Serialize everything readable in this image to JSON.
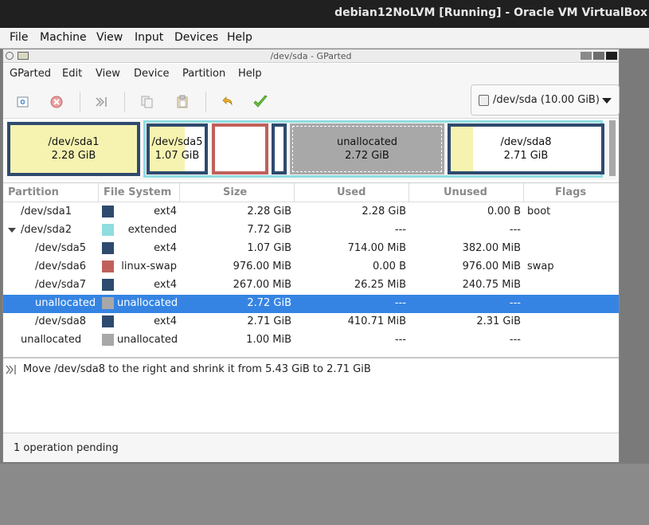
{
  "vbox": {
    "title": "debian12NoLVM [Running] - Oracle VM VirtualBox",
    "menu": [
      "File",
      "Machine",
      "View",
      "Input",
      "Devices",
      "Help"
    ]
  },
  "gparted": {
    "window_title": "/dev/sda - GParted",
    "menu": [
      "GParted",
      "Edit",
      "View",
      "Device",
      "Partition",
      "Help"
    ],
    "toolbar_icons": [
      "new-partition-icon",
      "delete-partition-icon",
      "resize-move-icon",
      "copy-icon",
      "paste-icon",
      "undo-icon",
      "apply-icon"
    ],
    "device_selector": "/dev/sda (10.00 GiB)",
    "diskmap": [
      {
        "name": "/dev/sda1",
        "size": "2.28 GiB"
      },
      {
        "name": "/dev/sda5",
        "size": "1.07 GiB"
      },
      {
        "name": "unallocated",
        "size": "2.72 GiB"
      },
      {
        "name": "/dev/sda8",
        "size": "2.71 GiB"
      }
    ],
    "columns": [
      "Partition",
      "File System",
      "Size",
      "Used",
      "Unused",
      "Flags"
    ],
    "rows": [
      {
        "partition": "/dev/sda1",
        "fs": "ext4",
        "size": "2.28 GiB",
        "used": "2.28 GiB",
        "unused": "0.00 B",
        "flags": "boot",
        "color": "#2e4a6e"
      },
      {
        "partition": "/dev/sda2",
        "fs": "extended",
        "size": "7.72 GiB",
        "used": "---",
        "unused": "---",
        "flags": "",
        "color": "#8fdde0"
      },
      {
        "partition": "/dev/sda5",
        "fs": "ext4",
        "size": "1.07 GiB",
        "used": "714.00 MiB",
        "unused": "382.00 MiB",
        "flags": "",
        "color": "#2e4a6e"
      },
      {
        "partition": "/dev/sda6",
        "fs": "linux-swap",
        "size": "976.00 MiB",
        "used": "0.00 B",
        "unused": "976.00 MiB",
        "flags": "swap",
        "color": "#c0605a"
      },
      {
        "partition": "/dev/sda7",
        "fs": "ext4",
        "size": "267.00 MiB",
        "used": "26.25 MiB",
        "unused": "240.75 MiB",
        "flags": "",
        "color": "#2e4a6e"
      },
      {
        "partition": "unallocated",
        "fs": "unallocated",
        "size": "2.72 GiB",
        "used": "---",
        "unused": "---",
        "flags": "",
        "color": "#a8a8a8"
      },
      {
        "partition": "/dev/sda8",
        "fs": "ext4",
        "size": "2.71 GiB",
        "used": "410.71 MiB",
        "unused": "2.31 GiB",
        "flags": "",
        "color": "#2e4a6e"
      },
      {
        "partition": "unallocated",
        "fs": "unallocated",
        "size": "1.00 MiB",
        "used": "---",
        "unused": "---",
        "flags": "",
        "color": "#a8a8a8"
      }
    ],
    "pending_operation": "Move /dev/sda8 to the right and shrink it from 5.43 GiB to 2.71 GiB",
    "status": "1 operation pending",
    "colors": {
      "ext4": "#2e4a6e",
      "extended": "#8fdde0",
      "swap": "#c0605a",
      "unallocated": "#a8a8a8",
      "used": "#f6f3b0",
      "selection": "#3584e4"
    }
  }
}
